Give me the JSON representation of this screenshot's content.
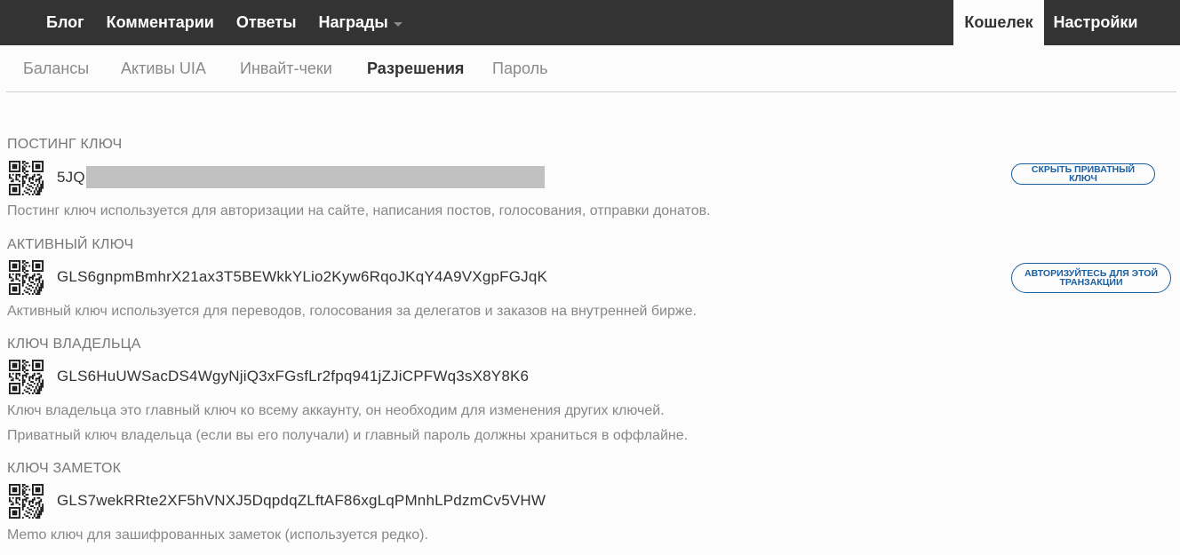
{
  "topnav": {
    "blog": "Блог",
    "comments": "Комментарии",
    "replies": "Ответы",
    "rewards": "Награды",
    "wallet": "Кошелек",
    "settings": "Настройки"
  },
  "subnav": {
    "balances": "Балансы",
    "assets": "Активы UIA",
    "invites": "Инвайт-чеки",
    "permissions": "Разрешения",
    "password": "Пароль"
  },
  "keys": {
    "posting": {
      "title": "ПОСТИНГ КЛЮЧ",
      "value": "5JQ",
      "button": "СКРЫТЬ ПРИВАТНЫЙ КЛЮЧ",
      "desc": "Постинг ключ используется для авторизации на сайте, написания постов, голосования, отправки донатов."
    },
    "active": {
      "title": "АКТИВНЫЙ КЛЮЧ",
      "value": "GLS6gnpmBmhrX21ax3T5BEWkkYLio2Kyw6RqoJKqY4A9VXgpFGJqK",
      "button": "АВТОРИЗУЙТЕСЬ ДЛЯ ЭТОЙ ТРАНЗАКЦИИ",
      "desc": "Активный ключ используется для переводов, голосования за делегатов и заказов на внутренней бирже."
    },
    "owner": {
      "title": "КЛЮЧ ВЛАДЕЛЬЦА",
      "value": "GLS6HuUWSacDS4WgyNjiQ3xFGsfLr2fpq941jZJiCPFWq3sX8Y8K6",
      "desc1": "Ключ владельца это главный ключ ко всему аккаунту, он необходим для изменения других ключей.",
      "desc2": "Приватный ключ владельца (если вы его получали) и главный пароль должны храниться в оффлайне."
    },
    "memo": {
      "title": "КЛЮЧ ЗАМЕТОК",
      "value": "GLS7wekRRte2XF5hVNXJ5DqpdqZLftAF86xgLqPMnhLPdzmCv5VHW",
      "desc": "Memo ключ для зашифрованных заметок (используется редко)."
    }
  },
  "colors": {
    "topbar": "#333333",
    "accent": "#1a5fa0",
    "mask": "#c1c1c1"
  }
}
